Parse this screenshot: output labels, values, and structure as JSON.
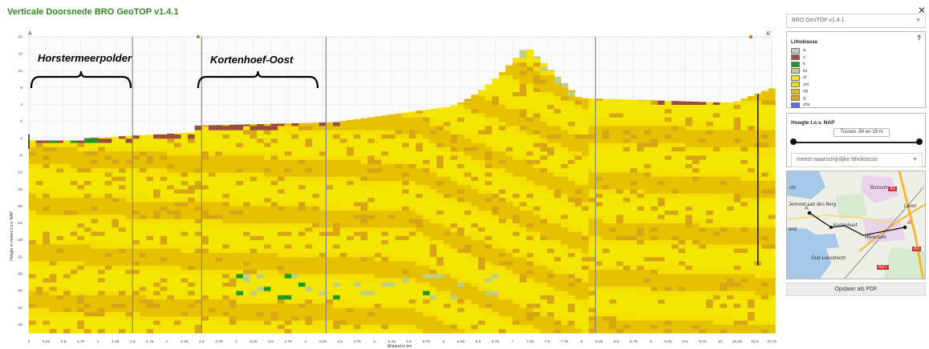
{
  "app": {
    "title": "Verticale Doorsnede BRO GeoTOP v1.4.1"
  },
  "section": {
    "start_label": "A",
    "end_label": "A'"
  },
  "annotations": {
    "left": "Horstermeerpolder",
    "right": "Kortenhoef-Oost"
  },
  "chart_data": {
    "type": "heatmap",
    "ylabel": "Hoogte in meters t.o.v. NAP",
    "xlabel": "Afstand in km",
    "ylim": [
      -50,
      20
    ],
    "xlim": [
      0,
      10.75
    ],
    "yticks": [
      "20",
      "16",
      "12",
      "8",
      "4",
      "0",
      "-4",
      "-8",
      "-12",
      "-16",
      "-20",
      "-24",
      "-28",
      "-32",
      "-36",
      "-40",
      "-44",
      "-48"
    ],
    "xticks": [
      "0",
      "0.25",
      "0.5",
      "0.75",
      "1",
      "1.25",
      "1.5",
      "1.75",
      "2",
      "2.25",
      "2.5",
      "2.75",
      "3",
      "3.25",
      "3.5",
      "3.75",
      "4",
      "4.25",
      "4.5",
      "4.75",
      "5",
      "5.25",
      "5.5",
      "5.75",
      "6",
      "6.25",
      "6.5",
      "6.75",
      "7",
      "7.25",
      "7.5",
      "7.75",
      "8",
      "8.25",
      "8.5",
      "8.75",
      "9",
      "9.25",
      "9.5",
      "9.75",
      "10",
      "10.25",
      "10.5",
      "10.75"
    ]
  },
  "panel": {
    "version_select": "BRO GeoTOP v1.4.1",
    "help": "?",
    "close": "✕",
    "legend_title": "Lithoklasse",
    "legend": [
      {
        "label": "a",
        "color": "#c8c8c8"
      },
      {
        "label": "v",
        "color": "#9b4b3b"
      },
      {
        "label": "k",
        "color": "#1e9a1e"
      },
      {
        "label": "kz",
        "color": "#bfcf82"
      },
      {
        "label": "zf",
        "color": "#f3e600"
      },
      {
        "label": "zm",
        "color": "#f5df00"
      },
      {
        "label": "zg",
        "color": "#e5c100"
      },
      {
        "label": "g",
        "color": "#d8a615"
      },
      {
        "label": "shs",
        "color": "#5b6fe6"
      }
    ],
    "hoogte_title": "Hoogte t.o.v. NAP",
    "range_label": "Tussen -50 en 19 m",
    "mode_select": "meest waarschijnlijke lithoklasse",
    "map_labels": [
      "cht",
      "Bussum",
      "A1",
      "Laren",
      "Jemond aan den Berg",
      "Kortenhoef",
      "Hilversum",
      "and",
      "Oud-Loosdrecht",
      "A27",
      "A1"
    ],
    "map_points": [
      "A",
      "A'"
    ],
    "pdf_button": "Opslaan als PDF"
  }
}
